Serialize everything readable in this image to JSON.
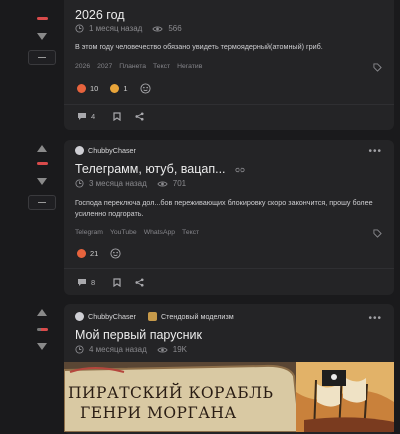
{
  "posts": [
    {
      "title": "2026 год",
      "time": "1 месяц назад",
      "views": "566",
      "text": "В этом году человечество обязано увидеть термоядерный(атомный) гриб.",
      "tags": [
        "2026",
        "2027",
        "Планета",
        "Текст",
        "Негатив"
      ],
      "reactions": [
        {
          "count": "10"
        },
        {
          "count": "1"
        }
      ],
      "comments": "4"
    },
    {
      "author": "ChubbyChaser",
      "title": "Телеграмм, ютуб, вацап...",
      "time": "3 месяца назад",
      "views": "701",
      "text_lines": [
        "Господа переключа дол...бов переживающих блокировку скоро закончится, прошу более",
        "усиленно подгорать."
      ],
      "tags": [
        "Telegram",
        "YouTube",
        "WhatsApp",
        "Текст"
      ],
      "reactions": [
        {
          "count": "21"
        }
      ],
      "comments": "8"
    },
    {
      "author": "ChubbyChaser",
      "community": "Стендовый моделизм",
      "title": "Мой первый парусник",
      "time": "4 месяца назад",
      "views": "19K",
      "image_text_1": "ПИРАТСКИЙ КОРАБЛЬ",
      "image_text_2": "ГЕНРИ МОРГАНА"
    }
  ],
  "colors": {
    "accent": "#d94b4b",
    "card": "#242426",
    "page": "#1a1a1c"
  },
  "icons": [
    "arrow-up-icon",
    "arrow-down-icon",
    "clock-icon",
    "eye-icon",
    "tag-icon",
    "comment-icon",
    "bookmark-icon",
    "share-icon",
    "add-reaction-icon",
    "more-icon",
    "link-icon"
  ]
}
